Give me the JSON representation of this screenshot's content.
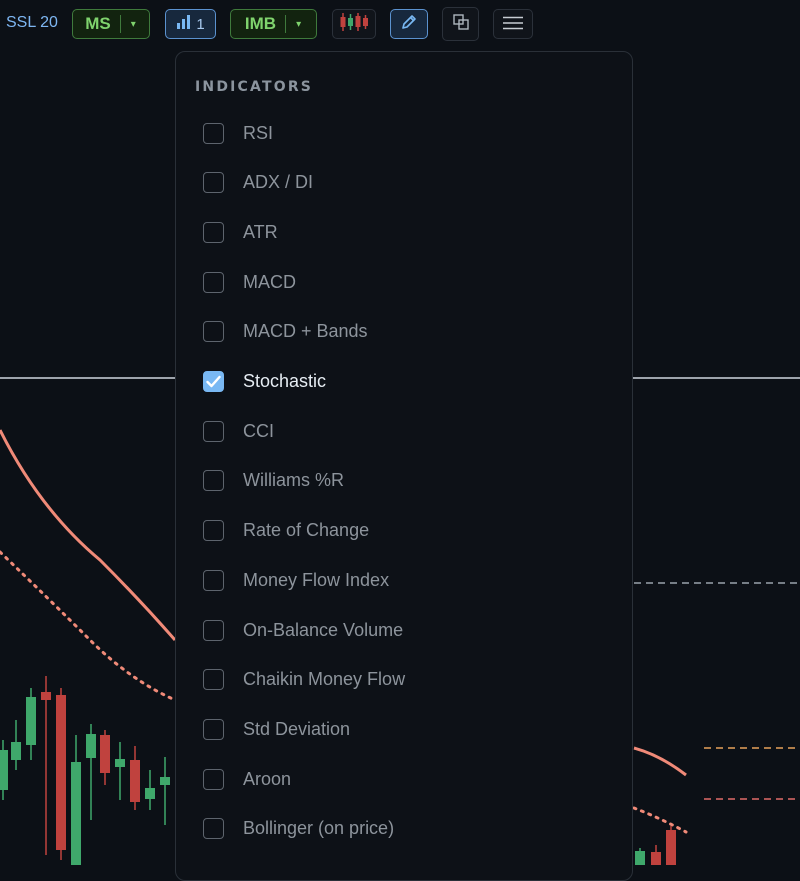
{
  "toolbar": {
    "ssl_label": "SSL 20",
    "ms_label": "MS",
    "indicator_count": "1",
    "imb_label": "IMB",
    "dropdown_arrow": "▾"
  },
  "menu": {
    "title": "INDICATORS",
    "items": [
      {
        "label": "RSI",
        "checked": false
      },
      {
        "label": "ADX / DI",
        "checked": false
      },
      {
        "label": "ATR",
        "checked": false
      },
      {
        "label": "MACD",
        "checked": false
      },
      {
        "label": "MACD + Bands",
        "checked": false
      },
      {
        "label": "Stochastic",
        "checked": true
      },
      {
        "label": "CCI",
        "checked": false
      },
      {
        "label": "Williams %R",
        "checked": false
      },
      {
        "label": "Rate of Change",
        "checked": false
      },
      {
        "label": "Money Flow Index",
        "checked": false
      },
      {
        "label": "On-Balance Volume",
        "checked": false
      },
      {
        "label": "Chaikin Money Flow",
        "checked": false
      },
      {
        "label": "Std Deviation",
        "checked": false
      },
      {
        "label": "Aroon",
        "checked": false
      },
      {
        "label": "Bollinger (on price)",
        "checked": false
      }
    ]
  },
  "colors": {
    "background": "#0c1016",
    "accent_blue": "#79b8f3",
    "green": "#7fd36d",
    "candle_up": "#3fa86b",
    "candle_down": "#c0423e",
    "ma_line": "#f08a78"
  },
  "icons": {
    "bar_chart": "bar-chart-icon",
    "candles": "candlestick-icon",
    "pencil": "pencil-icon",
    "layers": "layers-icon",
    "menu": "hamburger-menu-icon",
    "check": "check-icon"
  }
}
